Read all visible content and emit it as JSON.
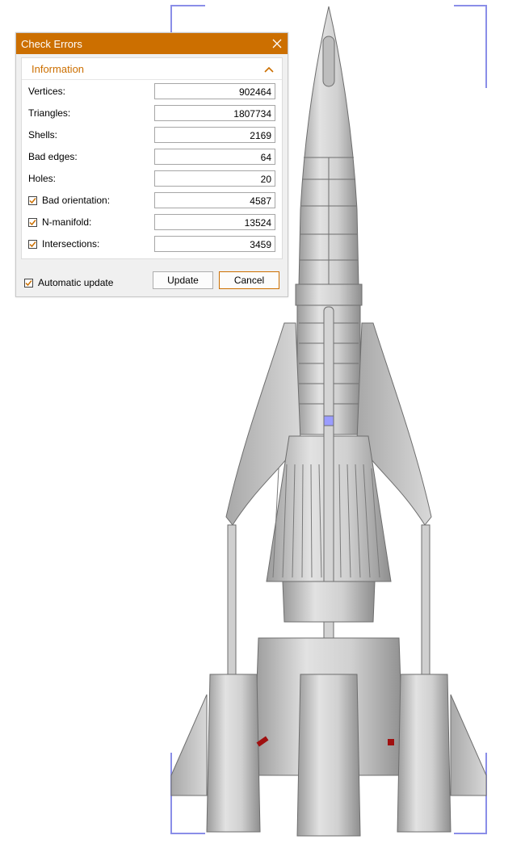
{
  "dialog": {
    "title": "Check Errors",
    "group_title": "Information",
    "rows": [
      {
        "label": "Vertices:",
        "value": "902464",
        "checkbox": false
      },
      {
        "label": "Triangles:",
        "value": "1807734",
        "checkbox": false
      },
      {
        "label": "Shells:",
        "value": "2169",
        "checkbox": false
      },
      {
        "label": "Bad edges:",
        "value": "64",
        "checkbox": false
      },
      {
        "label": "Holes:",
        "value": "20",
        "checkbox": false
      },
      {
        "label": "Bad orientation:",
        "value": "4587",
        "checkbox": true,
        "checked": true
      },
      {
        "label": "N-manifold:",
        "value": "13524",
        "checkbox": true,
        "checked": true
      },
      {
        "label": "Intersections:",
        "value": "3459",
        "checkbox": true,
        "checked": true
      }
    ],
    "auto_update_label": "Automatic update",
    "auto_update_checked": true,
    "update_label": "Update",
    "cancel_label": "Cancel"
  },
  "colors": {
    "accent": "#cc6f00",
    "bracket": "#8a8ee8",
    "model": "#c8c8c8",
    "error_mark": "#a01010",
    "selection": "#9a9cff"
  },
  "icons": {
    "close": "close-icon",
    "collapse": "chevron-up-icon",
    "check": "checkmark-icon"
  }
}
